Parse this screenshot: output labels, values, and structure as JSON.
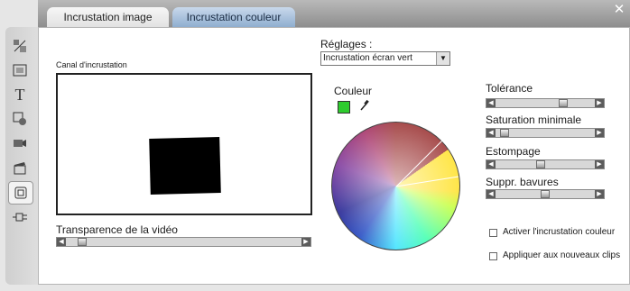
{
  "tabs": [
    {
      "label": "Incrustation image",
      "active": false
    },
    {
      "label": "Incrustation couleur",
      "active": true
    }
  ],
  "close_icon": "close-icon",
  "sidebar": {
    "icons": [
      "transition-icon",
      "frame-icon",
      "text-icon",
      "record-icon",
      "camera-icon",
      "clapboard-icon",
      "keying-icon",
      "plugin-icon"
    ],
    "selected": "keying-icon"
  },
  "left": {
    "preview_label": "Canal d'incrustation",
    "transparency_label": "Transparence de la vidéo",
    "transparency_value": 0.05
  },
  "settings": {
    "label": "Réglages :",
    "preset_value": "Incrustation écran vert",
    "dropdown_icon": "chevron-down-icon"
  },
  "color": {
    "label": "Couleur",
    "swatch_color": "#2ecc2e",
    "picker_icon": "eyedropper-icon"
  },
  "params": [
    {
      "label": "Tolérance",
      "value": 0.7
    },
    {
      "label": "Saturation minimale",
      "value": 0.05
    },
    {
      "label": "Estompage",
      "value": 0.45
    },
    {
      "label": "Suppr. bavures",
      "value": 0.5
    }
  ],
  "options": [
    {
      "label": "Activer l'incrustation couleur",
      "checked": false
    },
    {
      "label": "Appliquer aux nouveaux clips",
      "checked": false
    }
  ],
  "colors": {
    "active_tab": "#8faecf",
    "chip": "#2ecc2e"
  }
}
